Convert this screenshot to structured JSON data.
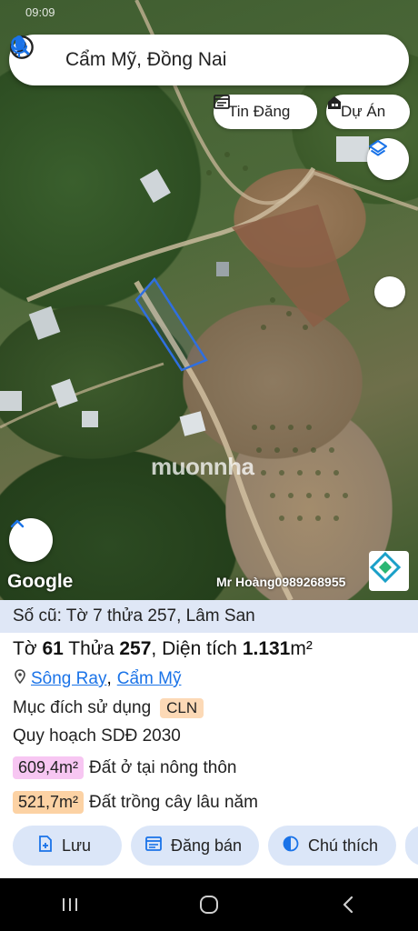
{
  "status_bar": {
    "time": "09:09"
  },
  "search": {
    "value": "Cẩm Mỹ, Đồng Nai"
  },
  "chips": {
    "listing": "Tin Đăng",
    "project": "Dự Án"
  },
  "map": {
    "attribution": "Google",
    "watermark": "muonnha",
    "agent_contact": "Mr Hoàng0989268955"
  },
  "panel": {
    "old_reference": "Số cũ: Tờ 7 thửa 257, Lâm San",
    "sheet_label": "Tờ",
    "sheet_number": "61",
    "parcel_label": "Thửa",
    "parcel_number": "257",
    "area_label": ", Diện tích",
    "area_value": "1.131",
    "area_unit": "m²",
    "commune": "Sông Ray",
    "district": "Cẩm Mỹ",
    "purpose_label": "Mục đích sử dụng",
    "purpose_code": "CLN",
    "plan_label": "Quy hoạch SDĐ 2030",
    "zones": [
      {
        "area": "609,4m²",
        "label": "Đất ở tại nông thôn",
        "color": "#f7c6f2"
      },
      {
        "area": "521,7m²",
        "label": "Đất trồng cây lâu năm",
        "color": "#fcd2a4"
      }
    ],
    "actions": {
      "save": "Lưu",
      "sell": "Đăng bán",
      "notes": "Chú thích"
    }
  },
  "colors": {
    "accent": "#1a73e8",
    "panel_header_bg": "#dfe7f6",
    "button_bg": "#dbe6f8",
    "parcel_outline": "#2f6fe0"
  }
}
